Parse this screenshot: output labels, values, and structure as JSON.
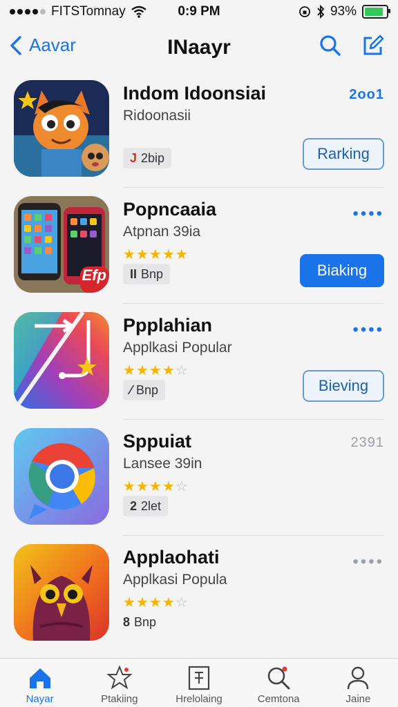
{
  "status": {
    "carrier": "FITSTomnay",
    "time": "0:9 PM",
    "battery": "93%",
    "battery_level": 0.93
  },
  "nav": {
    "back_label": "Aavar",
    "title": "INaayr"
  },
  "apps": [
    {
      "name": "Indom Idoonsiai",
      "subtitle": "Ridoonasii",
      "stars": 0,
      "chip": "2bip",
      "chip_icon": "J",
      "rank": "2oo1",
      "rank_style": "blue",
      "button": "Rarking",
      "button_style": "outline"
    },
    {
      "name": "Popncaaia",
      "subtitle": "Atpnan 39ia",
      "stars": 4.5,
      "chip": "Bnp",
      "chip_icon": "II",
      "more": "••••",
      "more_style": "blue",
      "button": "Biaking",
      "button_style": "filled",
      "icon_badge": "Efp"
    },
    {
      "name": "Ppplahian",
      "subtitle": "Applkasi Popular",
      "stars": 4,
      "chip": "Bnp",
      "chip_icon": "⁄",
      "more": "••••",
      "more_style": "blue",
      "button": "Bieving",
      "button_style": "outline"
    },
    {
      "name": "Sppuiat",
      "subtitle": "Lansee 39in",
      "stars": 4,
      "chip": "2let",
      "chip_icon": "2",
      "rank": "2391",
      "rank_style": "gray"
    },
    {
      "name": "Applaohati",
      "subtitle": "Applkasi Popula",
      "stars": 4,
      "chip": "Bnp",
      "chip_icon": "8",
      "more": "••••",
      "more_style": "gray"
    }
  ],
  "tabs": [
    {
      "label": "Nayar",
      "icon": "home-icon",
      "active": true
    },
    {
      "label": "Ptakiing",
      "icon": "star-icon",
      "active": false
    },
    {
      "label": "Hrelolaing",
      "icon": "list-icon",
      "active": false
    },
    {
      "label": "Cemtona",
      "icon": "search-icon",
      "active": false
    },
    {
      "label": "Jaine",
      "icon": "person-icon",
      "active": false
    }
  ],
  "colors": {
    "accent": "#1a73e8",
    "star": "#f4b400",
    "background": "#f4f4f5"
  }
}
